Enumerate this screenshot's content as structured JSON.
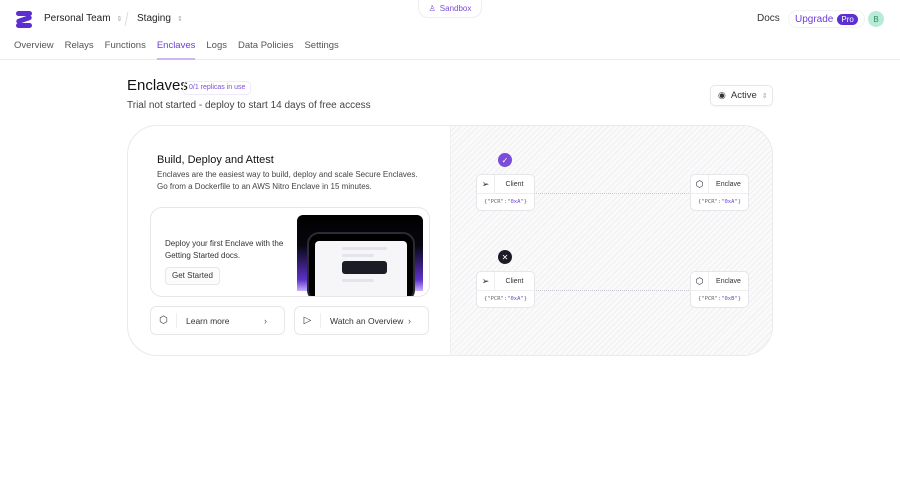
{
  "header": {
    "team": "Personal Team",
    "environment": "Staging",
    "sandbox": "Sandbox",
    "docs": "Docs",
    "upgrade": "Upgrade",
    "plan_badge": "Pro",
    "avatar_initial": "B"
  },
  "nav": {
    "tabs": [
      {
        "label": "Overview"
      },
      {
        "label": "Relays"
      },
      {
        "label": "Functions"
      },
      {
        "label": "Enclaves",
        "active": true
      },
      {
        "label": "Logs"
      },
      {
        "label": "Data Policies"
      },
      {
        "label": "Settings"
      }
    ]
  },
  "page": {
    "title": "Enclaves",
    "replicas_badge": "0/1 replicas in use",
    "subtitle": "Trial not started - deploy to start 14 days of free access",
    "status_filter": "Active"
  },
  "card": {
    "heading": "Build, Deploy and Attest",
    "description": "Enclaves are the easiest way to build, deploy and scale Secure Enclaves. Go from a Dockerfile to an AWS Nitro Enclave in 15 minutes.",
    "getting_started_text": "Deploy your first Enclave with the Getting Started docs.",
    "get_started_button": "Get Started",
    "learn_more": "Learn more",
    "watch_overview": "Watch an Overview"
  },
  "diagram": {
    "rows": [
      {
        "status": "success",
        "client_label": "Client",
        "client_pcr_key": "\"PCR\"",
        "client_pcr_val": "\"0xA\"",
        "enclave_label": "Enclave",
        "enclave_pcr_key": "\"PCR\"",
        "enclave_pcr_val": "\"0xA\""
      },
      {
        "status": "failure",
        "client_label": "Client",
        "client_pcr_key": "\"PCR\"",
        "client_pcr_val": "\"0xA\"",
        "enclave_label": "Enclave",
        "enclave_pcr_key": "\"PCR\"",
        "enclave_pcr_val": "\"0xB\""
      }
    ]
  },
  "colors": {
    "accent": "#6d3fd6",
    "pro": "#5b2fd0",
    "fail": "#1c1c26"
  }
}
